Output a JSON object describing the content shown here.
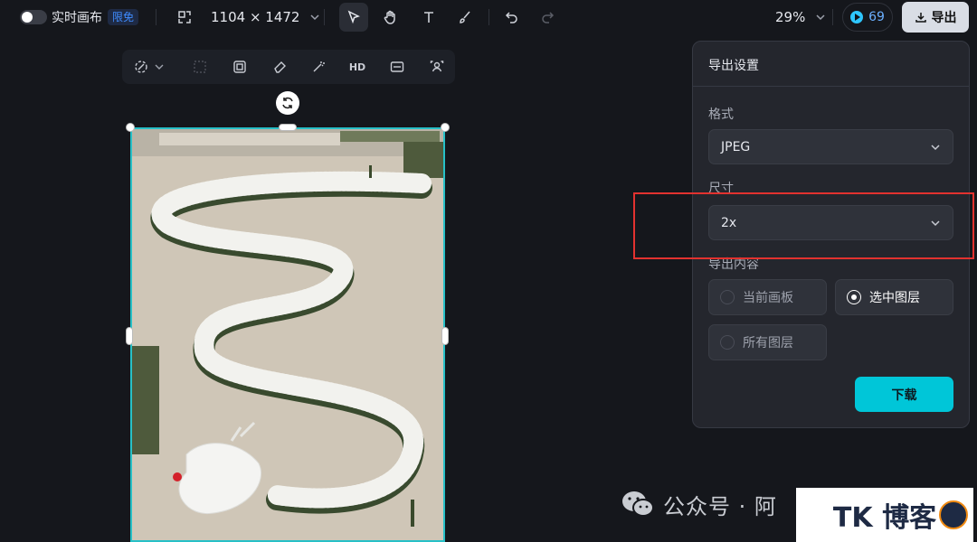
{
  "toolbar": {
    "realtime_canvas_label": "实时画布",
    "limited_badge": "限免",
    "canvas_size": "1104 × 1472",
    "zoom": "29%",
    "credits": "69",
    "export_label": "导出"
  },
  "float_toolbar": {
    "hd_label": "HD"
  },
  "export_panel": {
    "title": "导出设置",
    "format_label": "格式",
    "format_value": "JPEG",
    "size_label": "尺寸",
    "size_value": "2x",
    "content_label": "导出内容",
    "content_options": [
      {
        "label": "当前画板",
        "selected": false
      },
      {
        "label": "选中图层",
        "selected": true
      },
      {
        "label": "所有图层",
        "selected": false
      }
    ],
    "download_label": "下载"
  },
  "watermark": {
    "text": "公众号 · 阿",
    "box_text": "TK 博客"
  },
  "colors": {
    "accent": "#00c6d8",
    "highlight": "#e2322f",
    "selection": "#27c0c7"
  }
}
